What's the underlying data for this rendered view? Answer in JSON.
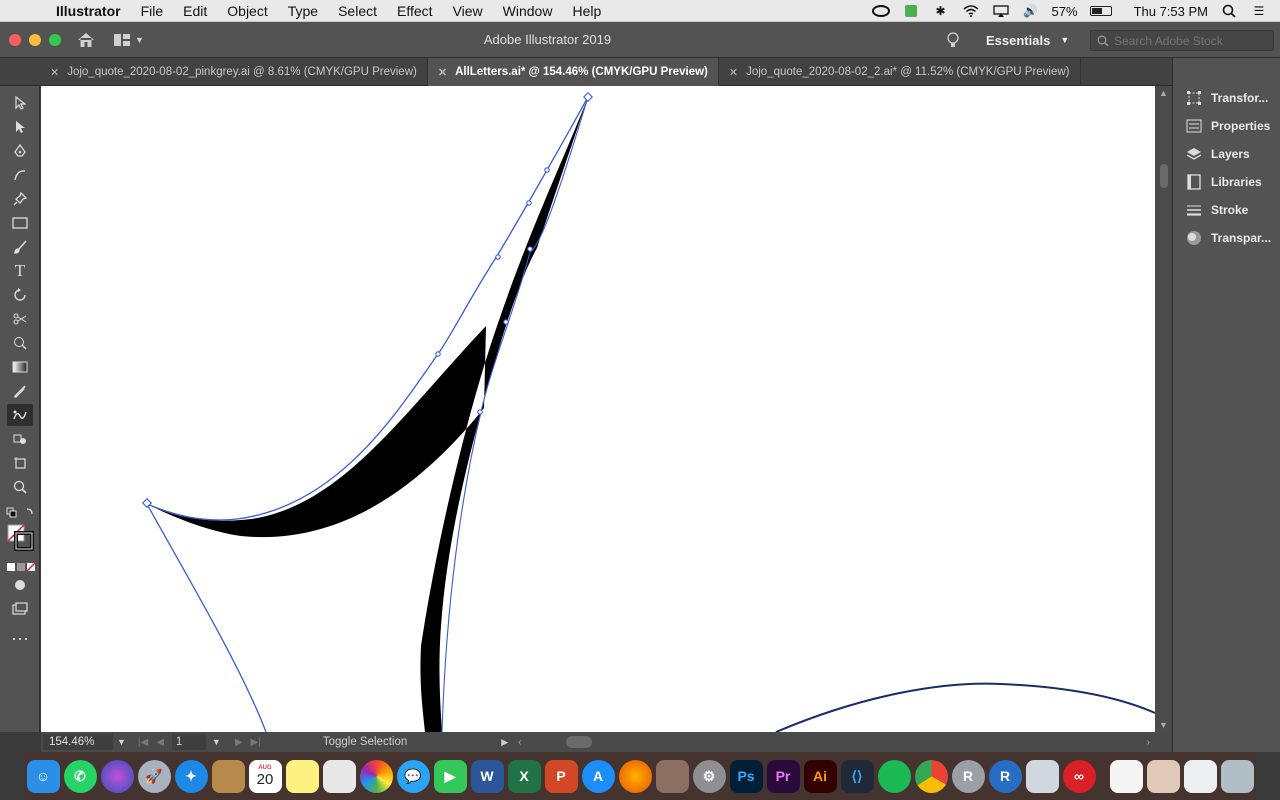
{
  "menubar": {
    "app_name": "Illustrator",
    "items": [
      "File",
      "Edit",
      "Object",
      "Type",
      "Select",
      "Effect",
      "View",
      "Window",
      "Help"
    ],
    "battery_percent": "57%",
    "battery_level": 0.57,
    "clock": "Thu 7:53 PM"
  },
  "titlebar": {
    "title": "Adobe Illustrator 2019",
    "workspace": "Essentials",
    "search_placeholder": "Search Adobe Stock"
  },
  "tabs": [
    {
      "label": "Jojo_quote_2020-08-02_pinkgrey.ai @ 8.61% (CMYK/GPU Preview)",
      "active": false
    },
    {
      "label": "AllLetters.ai* @ 154.46% (CMYK/GPU Preview)",
      "active": true
    },
    {
      "label": "Jojo_quote_2020-08-02_2.ai* @ 11.52% (CMYK/GPU Preview)",
      "active": false
    }
  ],
  "status": {
    "zoom": "154.46%",
    "artboard": "1",
    "tool_hint": "Toggle Selection"
  },
  "panels": [
    {
      "label": "Transfor...",
      "icon": "transform-icon"
    },
    {
      "label": "Properties",
      "icon": "properties-icon"
    },
    {
      "label": "Layers",
      "icon": "layers-icon"
    },
    {
      "label": "Libraries",
      "icon": "libraries-icon"
    },
    {
      "label": "Stroke",
      "icon": "stroke-icon"
    },
    {
      "label": "Transpar...",
      "icon": "transparency-icon"
    }
  ],
  "dock": {
    "calendar_month": "AUG",
    "calendar_day": "20",
    "apps": [
      "finder",
      "whatsapp",
      "siri",
      "launchpad",
      "safari",
      "notes-book",
      "calendar",
      "stickies",
      "preview",
      "photos",
      "messages",
      "facetime",
      "word",
      "excel",
      "powerpoint",
      "app-store",
      "firefox",
      "keychain",
      "system-preferences",
      "photoshop",
      "premiere",
      "illustrator",
      "vscode",
      "spotify",
      "chrome",
      "r-studio",
      "r",
      "image-capture",
      "creative-cloud",
      "document",
      "photo-stack",
      "file-browser",
      "trash"
    ]
  },
  "colors": {
    "selection_blue": "#3b5bdb",
    "fill": "#000000",
    "ui_dark": "#535353"
  }
}
